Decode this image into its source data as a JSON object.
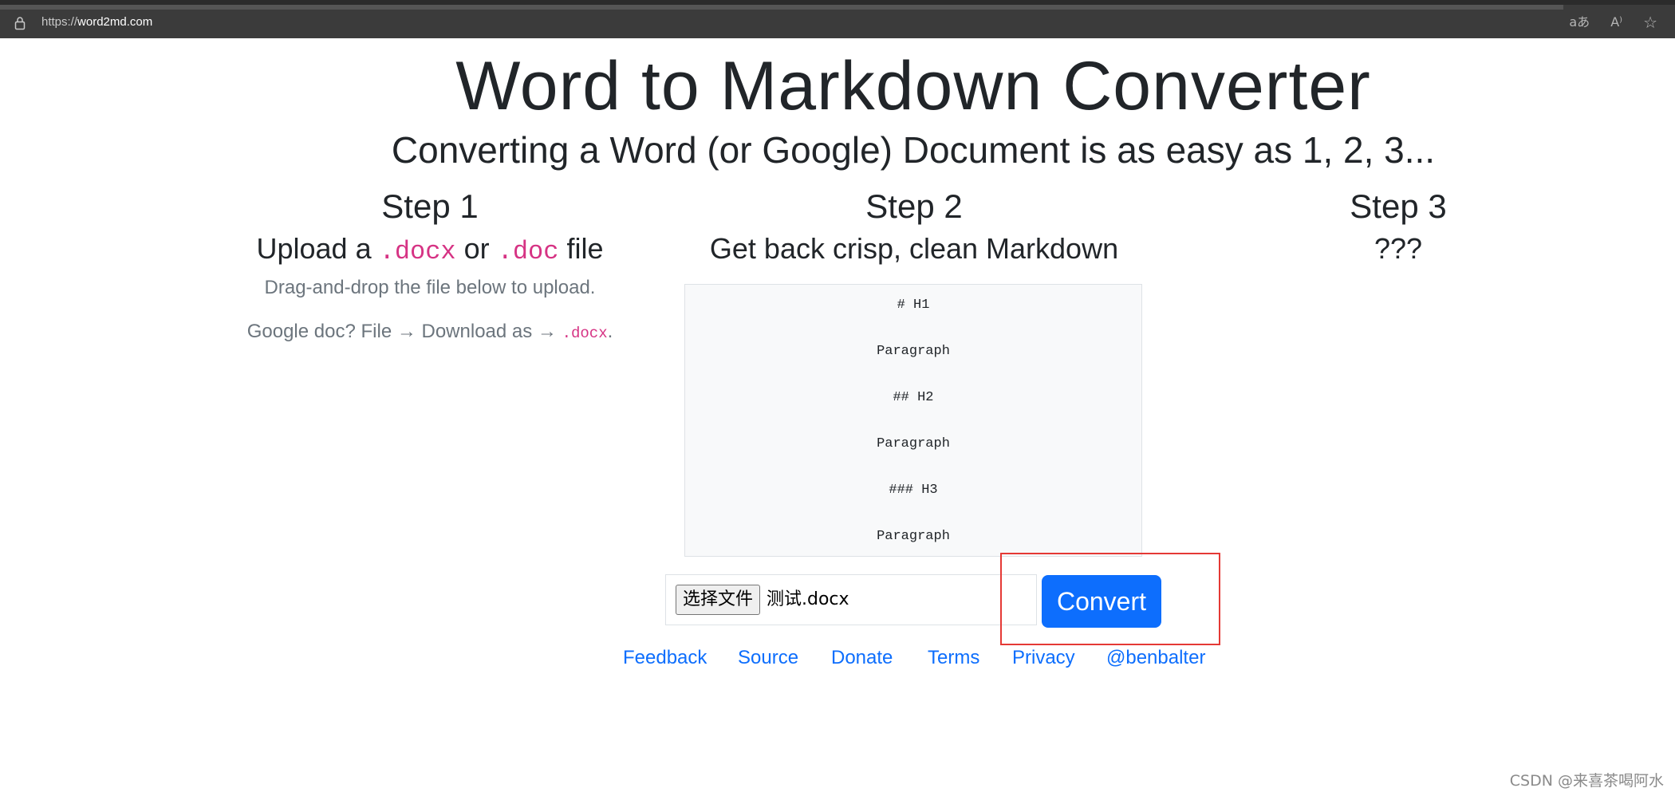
{
  "browser": {
    "url_scheme": "https://",
    "url_host": "word2md.com",
    "icons": [
      "translate-icon",
      "read-aloud-icon",
      "favorite-star-icon"
    ],
    "icon_glyphs": [
      "aあ",
      "A⁾",
      "☆"
    ]
  },
  "page": {
    "title": "Word to Markdown Converter",
    "subtitle": "Converting a Word (or Google) Document is as easy as 1, 2, 3...",
    "accent_color": "#0d6efd",
    "code_color": "#d63384"
  },
  "steps": [
    {
      "heading": "Step 1",
      "sub_prefix": "Upload a ",
      "sub_code1": ".docx",
      "sub_mid": " or ",
      "sub_code2": ".doc",
      "sub_suffix": " file",
      "note1": "Drag-and-drop the file below to upload.",
      "note2_prefix": "Google doc? File → Download as → ",
      "note2_code": ".docx",
      "note2_suffix": "."
    },
    {
      "heading": "Step 2",
      "sub": "Get back crisp, clean Markdown"
    },
    {
      "heading": "Step 3",
      "sub": "???"
    }
  ],
  "markdown_preview": [
    "# H1",
    "Paragraph",
    "## H2",
    "Paragraph",
    "### H3",
    "Paragraph"
  ],
  "upload": {
    "choose_button": "选择文件",
    "file_name": "测试.docx",
    "convert_label": "Convert"
  },
  "footer": {
    "links": [
      "Feedback",
      "Source",
      "Donate",
      "Terms",
      "Privacy",
      "@benbalter"
    ]
  },
  "watermark": "CSDN @来喜茶喝阿水"
}
